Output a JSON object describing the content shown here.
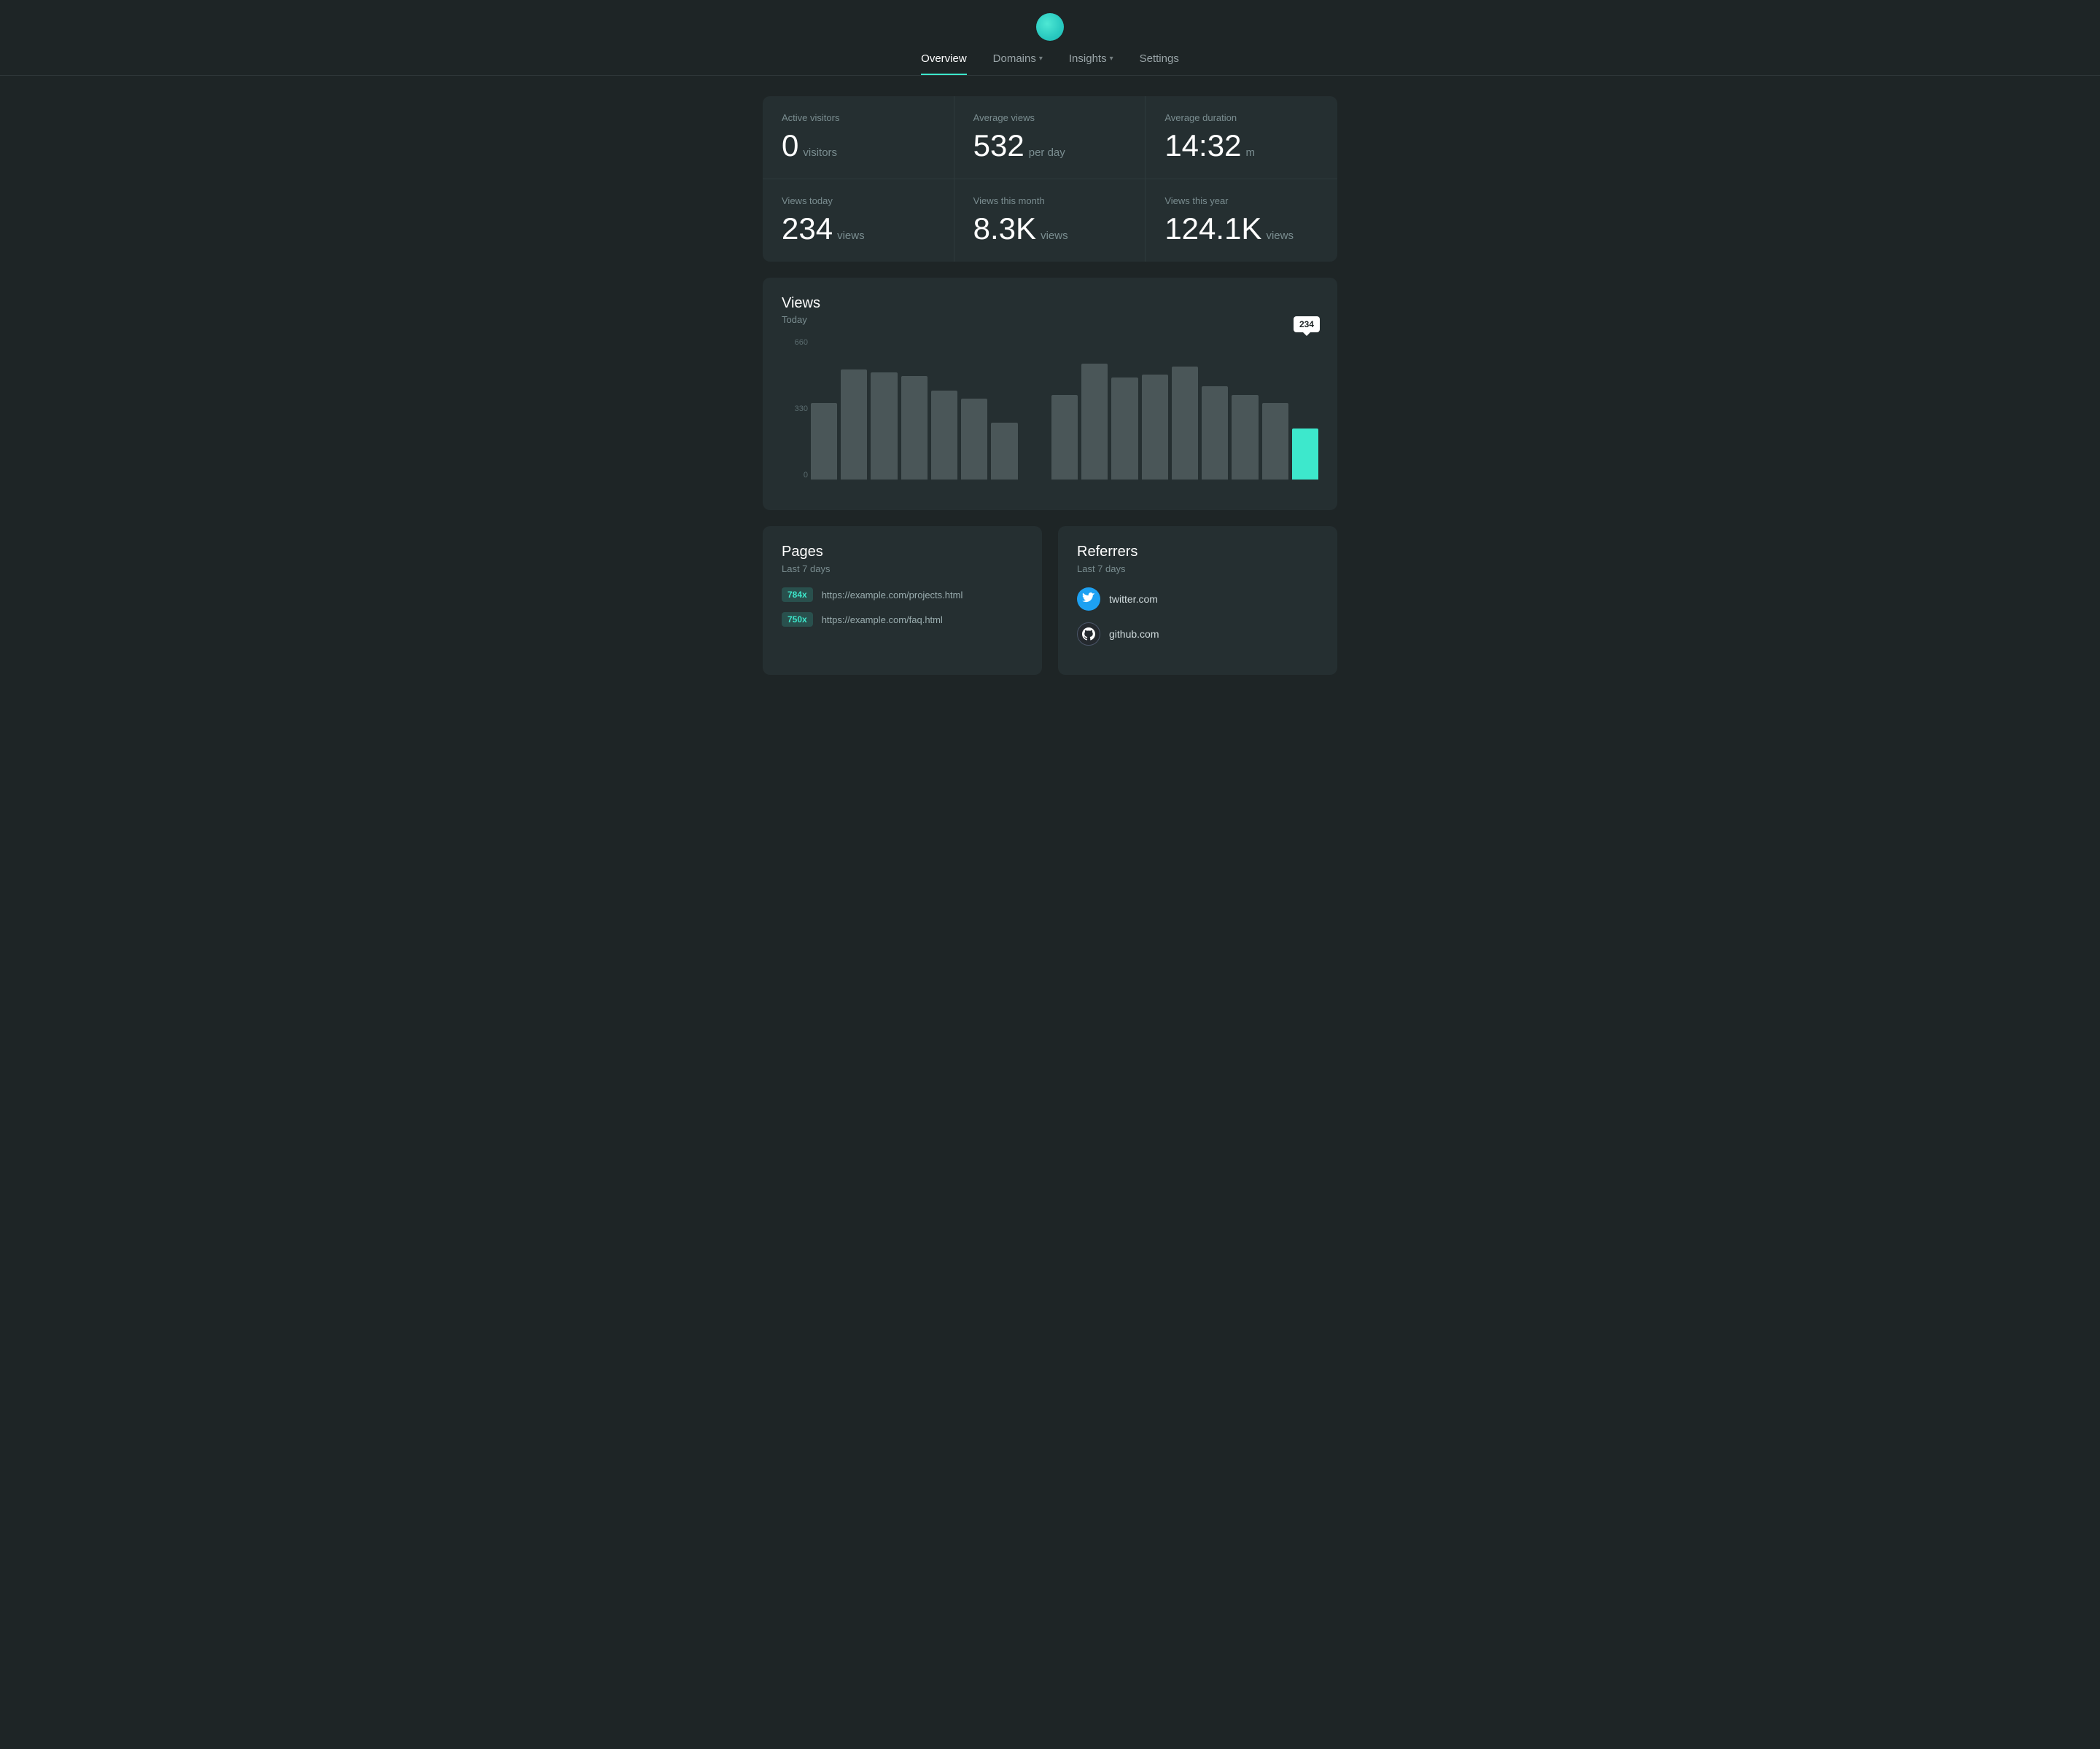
{
  "nav": {
    "links": [
      {
        "id": "overview",
        "label": "Overview",
        "active": true,
        "hasChevron": false
      },
      {
        "id": "domains",
        "label": "Domains",
        "active": false,
        "hasChevron": true
      },
      {
        "id": "insights",
        "label": "Insights",
        "active": false,
        "hasChevron": true
      },
      {
        "id": "settings",
        "label": "Settings",
        "active": false,
        "hasChevron": false
      }
    ]
  },
  "stats": [
    {
      "id": "active-visitors",
      "label": "Active visitors",
      "value": "0",
      "unit": "visitors"
    },
    {
      "id": "average-views",
      "label": "Average views",
      "value": "532",
      "unit": "per day"
    },
    {
      "id": "average-duration",
      "label": "Average duration",
      "value": "14:32",
      "unit": "m"
    },
    {
      "id": "views-today",
      "label": "Views today",
      "value": "234",
      "unit": "views"
    },
    {
      "id": "views-month",
      "label": "Views this month",
      "value": "8.3K",
      "unit": "views"
    },
    {
      "id": "views-year",
      "label": "Views this year",
      "value": "124.1K",
      "unit": "views"
    }
  ],
  "chart": {
    "title": "Views",
    "subtitle": "Today",
    "y_labels": [
      "660",
      "330",
      "0"
    ],
    "tooltip_value": "234",
    "bars": [
      {
        "id": "bar1",
        "height_pct": 54,
        "accent": false
      },
      {
        "id": "bar2",
        "height_pct": 78,
        "accent": false
      },
      {
        "id": "bar3",
        "height_pct": 76,
        "accent": false
      },
      {
        "id": "bar4",
        "height_pct": 73,
        "accent": false
      },
      {
        "id": "bar5",
        "height_pct": 63,
        "accent": false
      },
      {
        "id": "bar6",
        "height_pct": 57,
        "accent": false
      },
      {
        "id": "bar7",
        "height_pct": 40,
        "accent": false
      },
      {
        "id": "bar8",
        "height_pct": 0,
        "accent": false
      },
      {
        "id": "bar9",
        "height_pct": 60,
        "accent": false
      },
      {
        "id": "bar10",
        "height_pct": 82,
        "accent": false
      },
      {
        "id": "bar11",
        "height_pct": 72,
        "accent": false
      },
      {
        "id": "bar12",
        "height_pct": 74,
        "accent": false
      },
      {
        "id": "bar13",
        "height_pct": 80,
        "accent": false
      },
      {
        "id": "bar14",
        "height_pct": 66,
        "accent": false
      },
      {
        "id": "bar15",
        "height_pct": 60,
        "accent": false
      },
      {
        "id": "bar16",
        "height_pct": 54,
        "accent": false
      },
      {
        "id": "bar17",
        "height_pct": 36,
        "accent": true
      }
    ]
  },
  "pages": {
    "title": "Pages",
    "subtitle": "Last 7 days",
    "items": [
      {
        "count": "784x",
        "url": "https://example.com/projects.html"
      },
      {
        "count": "750x",
        "url": "https://example.com/faq.html"
      }
    ]
  },
  "referrers": {
    "title": "Referrers",
    "subtitle": "Last 7 days",
    "items": [
      {
        "name": "twitter.com",
        "icon_type": "twitter"
      },
      {
        "name": "github.com",
        "icon_type": "github"
      }
    ]
  }
}
